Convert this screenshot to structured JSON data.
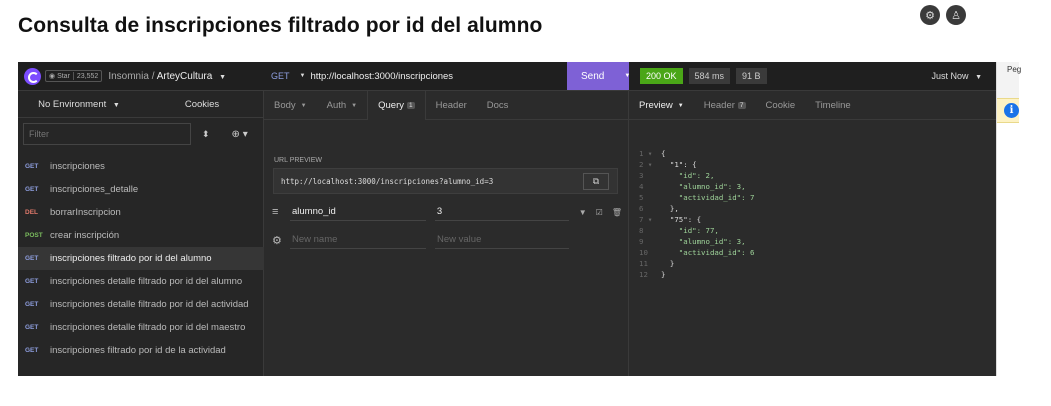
{
  "document": {
    "title": "Consulta de inscripciones filtrado por id del alumno"
  },
  "app": {
    "star_label": "Star",
    "star_count": "23,552",
    "app_name": "Insomnia",
    "separator": "/",
    "workspace": "ArteyCultura"
  },
  "sidebar": {
    "environment": "No Environment",
    "cookies": "Cookies",
    "filter_placeholder": "Filter",
    "requests": [
      {
        "method": "GET",
        "name": "inscripciones"
      },
      {
        "method": "GET",
        "name": "inscripciones_detalle"
      },
      {
        "method": "DEL",
        "name": "borrarInscripcion"
      },
      {
        "method": "POST",
        "name": "crear inscripción"
      },
      {
        "method": "GET",
        "name": "inscripciones filtrado por id del alumno"
      },
      {
        "method": "GET",
        "name": "inscripciones detalle filtrado por id del alumno"
      },
      {
        "method": "GET",
        "name": "inscripciones detalle filtrado por id del actividad"
      },
      {
        "method": "GET",
        "name": "inscripciones detalle filtrado por id del maestro"
      },
      {
        "method": "GET",
        "name": "inscripciones filtrado por id de la actividad"
      }
    ]
  },
  "request": {
    "method": "GET",
    "url": "http://localhost:3000/inscripciones",
    "send_label": "Send",
    "tabs": {
      "body": "Body",
      "auth": "Auth",
      "query": "Query",
      "query_count": "1",
      "header": "Header",
      "docs": "Docs"
    },
    "url_preview_label": "URL PREVIEW",
    "url_preview": "http://localhost:3000/inscripciones?alumno_id=3",
    "params": [
      {
        "name": "alumno_id",
        "value": "3"
      }
    ],
    "new_name_placeholder": "New name",
    "new_value_placeholder": "New value"
  },
  "response": {
    "status": "200 OK",
    "time": "584 ms",
    "size": "91 B",
    "timestamp": "Just Now",
    "tabs": {
      "preview": "Preview",
      "header": "Header",
      "header_count": "7",
      "cookie": "Cookie",
      "timeline": "Timeline"
    },
    "lines": [
      {
        "n": "1",
        "fold": "▾",
        "text": "{"
      },
      {
        "n": "2",
        "fold": "▾",
        "text": "  \"1\": {"
      },
      {
        "n": "3",
        "fold": "",
        "text": "    \"id\": 2,"
      },
      {
        "n": "4",
        "fold": "",
        "text": "    \"alumno_id\": 3,"
      },
      {
        "n": "5",
        "fold": "",
        "text": "    \"actividad_id\": 7"
      },
      {
        "n": "6",
        "fold": "",
        "text": "  },"
      },
      {
        "n": "7",
        "fold": "▾",
        "text": "  \"75\": {"
      },
      {
        "n": "8",
        "fold": "",
        "text": "    \"id\": 77,"
      },
      {
        "n": "9",
        "fold": "",
        "text": "    \"alumno_id\": 3,"
      },
      {
        "n": "10",
        "fold": "",
        "text": "    \"actividad_id\": 6"
      },
      {
        "n": "11",
        "fold": "",
        "text": "  }"
      },
      {
        "n": "12",
        "fold": "",
        "text": "}"
      }
    ]
  },
  "browser": {
    "corner_text": "Peg"
  },
  "colors": {
    "accent": "#7e61d6",
    "status_ok": "#4aa617",
    "get": "#8e9edf",
    "del": "#e0796b",
    "post": "#7bbd5e"
  },
  "icons": {
    "settings": "gear-icon",
    "account": "user-icon",
    "info": "info-icon"
  }
}
